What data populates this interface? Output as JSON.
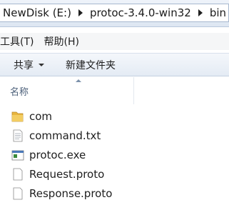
{
  "address_bar": {
    "crumbs": [
      "NewDisk (E:)",
      "protoc-3.4.0-win32",
      "bin"
    ]
  },
  "menu": {
    "items": [
      "工具(T)",
      "帮助(H)"
    ]
  },
  "toolbar": {
    "share_label": "共享",
    "new_folder_label": "新建文件夹"
  },
  "columns": {
    "name_header": "名称"
  },
  "files": [
    {
      "name": "com",
      "icon": "folder-icon"
    },
    {
      "name": "command.txt",
      "icon": "text-file-icon"
    },
    {
      "name": "protoc.exe",
      "icon": "exe-icon"
    },
    {
      "name": "Request.proto",
      "icon": "file-icon"
    },
    {
      "name": "Response.proto",
      "icon": "file-icon"
    }
  ],
  "colors": {
    "folder": "#e8b53f",
    "accent": "#4c607a"
  }
}
